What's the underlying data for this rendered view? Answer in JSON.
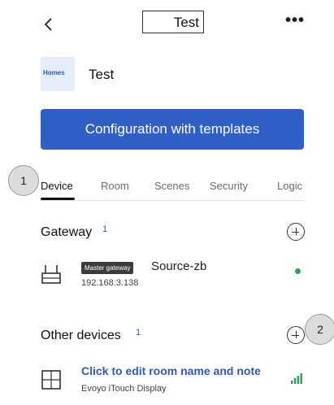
{
  "header": {
    "title": "Test"
  },
  "home": {
    "logo_text": "Homes",
    "name": "Test"
  },
  "primary_action": {
    "label": "Configuration with templates"
  },
  "tabs": [
    {
      "label": "Device",
      "active": true
    },
    {
      "label": "Room",
      "active": false
    },
    {
      "label": "Scenes",
      "active": false
    },
    {
      "label": "Security",
      "active": false
    },
    {
      "label": "Logic",
      "active": false
    }
  ],
  "gateway_section": {
    "title": "Gateway",
    "count": "1",
    "items": [
      {
        "badge": "Master gateway",
        "name": "Source-zb",
        "ip": "192.168.3.138",
        "status_color": "#2aa55a"
      }
    ]
  },
  "other_devices_section": {
    "title": "Other devices",
    "count": "1",
    "items": [
      {
        "name": "Click to edit room name and note",
        "model": "Evoyo iTouch Display",
        "signal_color": "#2aa55a"
      }
    ]
  },
  "step_markers": {
    "first": "1",
    "second": "2"
  },
  "colors": {
    "accent": "#2f5fc7",
    "link": "#2f58b9",
    "online": "#2aa55a"
  }
}
